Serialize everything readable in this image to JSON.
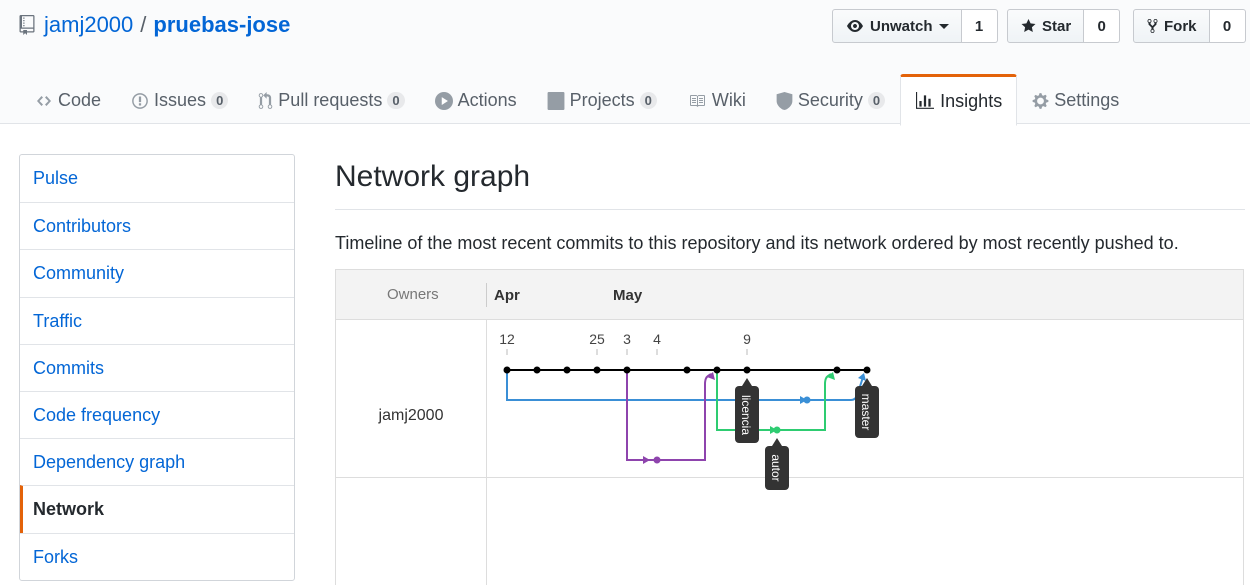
{
  "repo": {
    "owner": "jamj2000",
    "separator": "/",
    "name": "pruebas-jose",
    "icon": "repo-icon"
  },
  "actions": {
    "watch": {
      "label": "Unwatch",
      "count": "1",
      "icon": "eye-icon"
    },
    "star": {
      "label": "Star",
      "count": "0",
      "icon": "star-icon"
    },
    "fork": {
      "label": "Fork",
      "count": "0",
      "icon": "fork-icon"
    }
  },
  "tabs": [
    {
      "label": "Code",
      "icon": "code-icon"
    },
    {
      "label": "Issues",
      "count": "0",
      "icon": "issue-icon"
    },
    {
      "label": "Pull requests",
      "count": "0",
      "icon": "pull-request-icon"
    },
    {
      "label": "Actions",
      "icon": "play-icon"
    },
    {
      "label": "Projects",
      "count": "0",
      "icon": "project-icon"
    },
    {
      "label": "Wiki",
      "icon": "book-icon"
    },
    {
      "label": "Security",
      "count": "0",
      "icon": "shield-icon"
    },
    {
      "label": "Insights",
      "icon": "graph-icon",
      "selected": true
    },
    {
      "label": "Settings",
      "icon": "gear-icon"
    }
  ],
  "sidebar": {
    "items": [
      {
        "label": "Pulse"
      },
      {
        "label": "Contributors"
      },
      {
        "label": "Community"
      },
      {
        "label": "Traffic"
      },
      {
        "label": "Commits"
      },
      {
        "label": "Code frequency"
      },
      {
        "label": "Dependency graph"
      },
      {
        "label": "Network",
        "selected": true
      },
      {
        "label": "Forks"
      }
    ]
  },
  "page": {
    "title": "Network graph",
    "description": "Timeline of the most recent commits to this repository and its network ordered by most recently pushed to."
  },
  "network": {
    "owners_label": "Owners",
    "months": [
      "Apr",
      "May"
    ],
    "days": [
      "12",
      "25",
      "3",
      "4",
      "9"
    ],
    "owner": "jamj2000",
    "branches": [
      {
        "name": "licencia",
        "color": "#3a8fd6"
      },
      {
        "name": "autor",
        "color": "#2ecc71"
      },
      {
        "name": "master",
        "color": "#000000"
      }
    ],
    "colors": {
      "master": "#000000",
      "blue": "#3a8fd6",
      "purple": "#8e44ad",
      "green": "#2ecc71",
      "accent": "#e36209",
      "link": "#0366d6"
    }
  }
}
